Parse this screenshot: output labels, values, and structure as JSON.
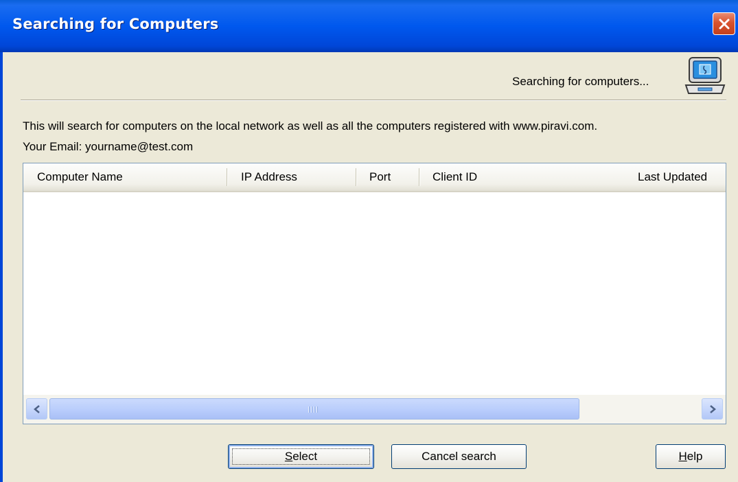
{
  "window": {
    "title": "Searching for Computers"
  },
  "header": {
    "status": "Searching for computers...",
    "icon": "computer-icon"
  },
  "body": {
    "description": "This will search for computers on the local network as well as all the computers registered with www.piravi.com.",
    "email_line": "Your Email: yourname@test.com"
  },
  "table": {
    "columns": [
      "Computer Name",
      "IP Address",
      "Port",
      "Client ID",
      "Last Updated"
    ],
    "rows": []
  },
  "buttons": {
    "select": {
      "accel": "S",
      "rest": "elect"
    },
    "cancel": "Cancel search",
    "help": {
      "accel": "H",
      "rest": "elp"
    }
  },
  "colors": {
    "titlebar": "#0058ee",
    "dialog_bg": "#ece9d8",
    "close_button": "#d9532f",
    "scrollbar": "#c3d4fb"
  }
}
